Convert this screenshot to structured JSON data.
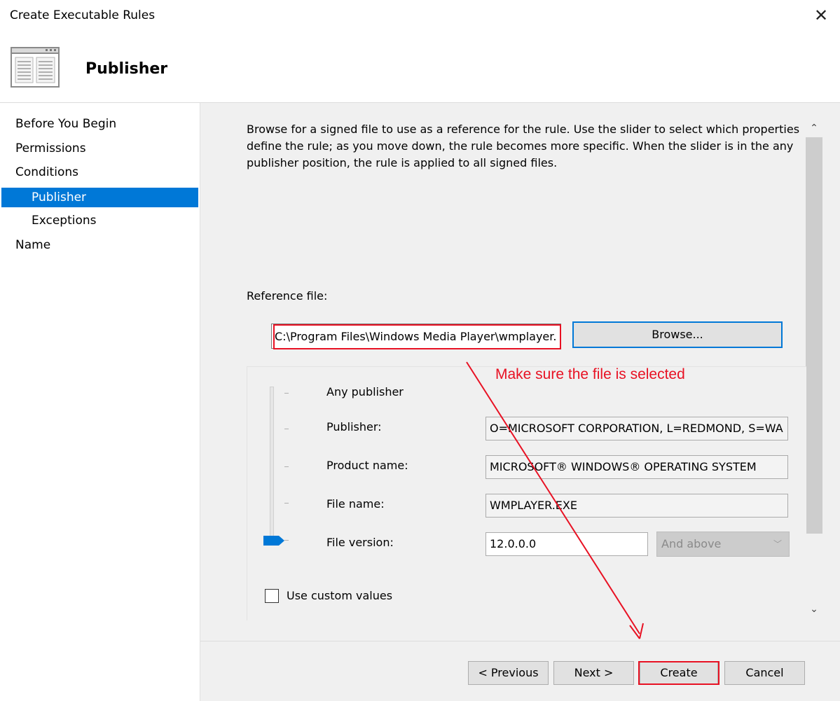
{
  "window": {
    "title": "Create Executable Rules"
  },
  "header": {
    "title": "Publisher"
  },
  "nav": {
    "items": [
      {
        "label": "Before You Begin"
      },
      {
        "label": "Permissions"
      },
      {
        "label": "Conditions"
      },
      {
        "label": "Publisher",
        "selected": true
      },
      {
        "label": "Exceptions"
      },
      {
        "label": "Name"
      }
    ]
  },
  "main": {
    "description": "Browse for a signed file to use as a reference for the rule. Use the slider to select which properties\ndefine the rule; as you move down, the rule becomes more specific. When the slider is in the any\npublisher position, the rule is applied to all signed files.",
    "reference_label": "Reference file:",
    "reference_value": "C:\\Program Files\\Windows Media Player\\wmplayer.",
    "browse_label": "Browse...",
    "annotation": "Make sure the file is selected",
    "any_publisher_label": "Any publisher",
    "properties": [
      {
        "label": "Publisher:",
        "value": "O=MICROSOFT CORPORATION, L=REDMOND, S=WA"
      },
      {
        "label": "Product name:",
        "value": "MICROSOFT® WINDOWS® OPERATING SYSTEM"
      },
      {
        "label": "File name:",
        "value": "WMPLAYER.EXE"
      },
      {
        "label": "File version:",
        "value": "12.0.0.0"
      }
    ],
    "version_operator": "And above",
    "custom_values_label": "Use custom values",
    "slider_level": "File version"
  },
  "footer": {
    "previous": "< Previous",
    "next": "Next >",
    "create": "Create",
    "cancel": "Cancel"
  },
  "colors": {
    "accent": "#0078d7",
    "annotation": "#e81123"
  }
}
